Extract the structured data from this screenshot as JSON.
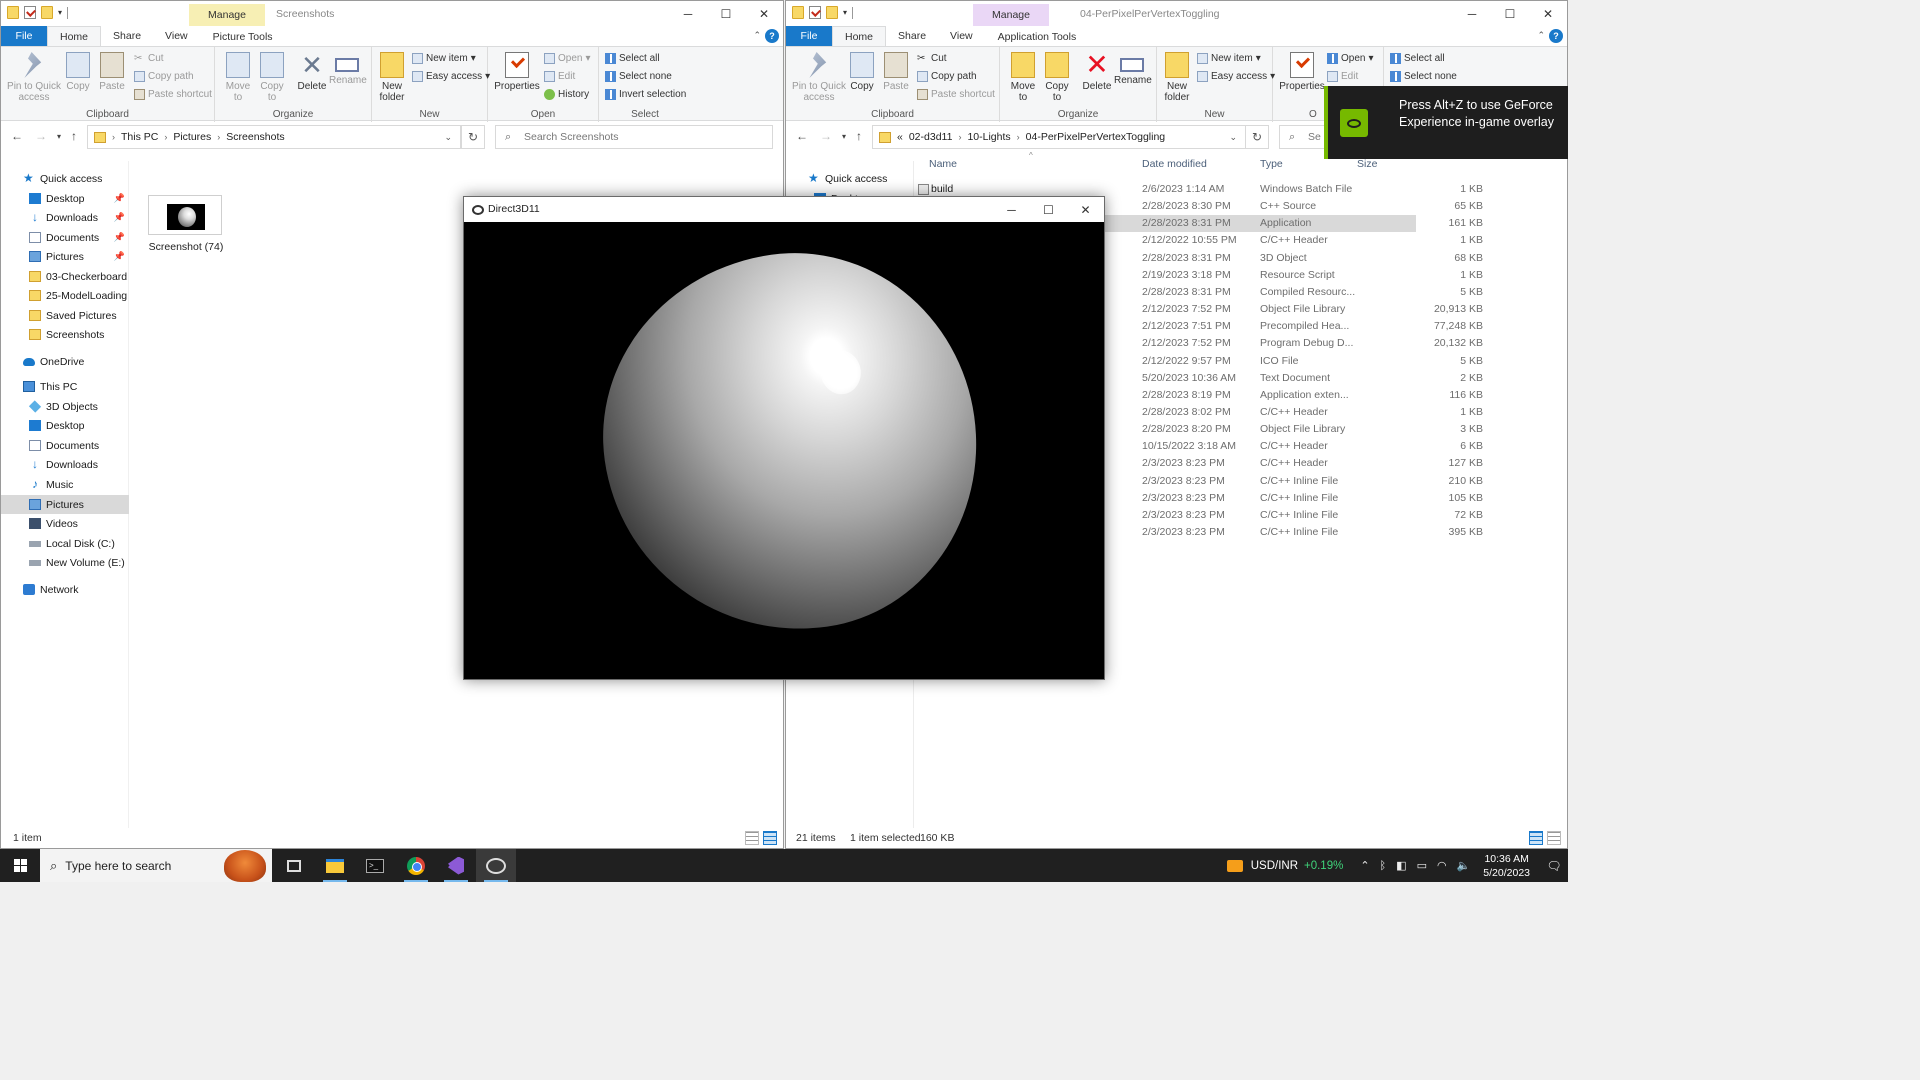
{
  "left": {
    "manage": "Manage",
    "title": "Screenshots",
    "tabs": [
      "File",
      "Home",
      "Share",
      "View",
      "Picture Tools"
    ],
    "ribbon": {
      "pin": "Pin to Quick access",
      "copy": "Copy",
      "paste": "Paste",
      "cut": "Cut",
      "copy_path": "Copy path",
      "paste_shortcut": "Paste shortcut",
      "clipboard": "Clipboard",
      "move_to": "Move to",
      "copy_to": "Copy to",
      "delete": "Delete",
      "rename": "Rename",
      "organize": "Organize",
      "new_folder": "New folder",
      "new_item": "New item",
      "easy_access": "Easy access",
      "new": "New",
      "properties": "Properties",
      "open": "Open",
      "edit": "Edit",
      "history": "History",
      "open_group": "Open",
      "select_all": "Select all",
      "select_none": "Select none",
      "invert_selection": "Invert selection",
      "select": "Select"
    },
    "path": [
      "This PC",
      "Pictures",
      "Screenshots"
    ],
    "search_placeholder": "Search Screenshots",
    "nav": {
      "quick_access": "Quick access",
      "desktop": "Desktop",
      "downloads": "Downloads",
      "documents": "Documents",
      "pictures": "Pictures",
      "checkerboard": "03-Checkerboard",
      "modelloading": "25-ModelLoading",
      "saved_pictures": "Saved Pictures",
      "screenshots": "Screenshots",
      "onedrive": "OneDrive",
      "this_pc": "This PC",
      "objects3d": "3D Objects",
      "pc_desktop": "Desktop",
      "pc_documents": "Documents",
      "pc_downloads": "Downloads",
      "music": "Music",
      "pc_pictures": "Pictures",
      "videos": "Videos",
      "local_disk": "Local Disk (C:)",
      "new_volume": "New Volume (E:)",
      "network": "Network"
    },
    "file_label": "Screenshot (74)",
    "status": "1 item"
  },
  "right": {
    "manage": "Manage",
    "title": "04-PerPixelPerVertexToggling",
    "tabs": [
      "File",
      "Home",
      "Share",
      "View",
      "Application Tools"
    ],
    "ribbon": {
      "pin": "Pin to Quick access",
      "copy": "Copy",
      "paste": "Paste",
      "cut": "Cut",
      "copy_path": "Copy path",
      "paste_shortcut": "Paste shortcut",
      "clipboard": "Clipboard",
      "move_to": "Move to",
      "copy_to": "Copy to",
      "delete": "Delete",
      "rename": "Rename",
      "organize": "Organize",
      "new_folder": "New folder",
      "new_item": "New item",
      "easy_access": "Easy access",
      "new": "New",
      "properties": "Properties",
      "open": "Open",
      "edit": "Edit",
      "open_group": "O",
      "select_all": "Select all",
      "select_none": "Select none"
    },
    "path": [
      "«",
      "02-d3d11",
      "10-Lights",
      "04-PerPixelPerVertexToggling"
    ],
    "search_placeholder": "Se",
    "nav": {
      "quick_access": "Quick access",
      "desktop": "Desktop"
    },
    "columns": [
      "Name",
      "Date modified",
      "Type",
      "Size"
    ],
    "files": [
      {
        "name": "build",
        "date": "2/6/2023 1:14 AM",
        "type": "Windows Batch File",
        "size": "1 KB"
      },
      {
        "name": "",
        "date": "2/28/2023 8:30 PM",
        "type": "C++ Source",
        "size": "65 KB"
      },
      {
        "name": "",
        "date": "2/28/2023 8:31 PM",
        "type": "Application",
        "size": "161 KB"
      },
      {
        "name": "",
        "date": "2/12/2022 10:55 PM",
        "type": "C/C++ Header",
        "size": "1 KB"
      },
      {
        "name": "",
        "date": "2/28/2023 8:31 PM",
        "type": "3D Object",
        "size": "68 KB"
      },
      {
        "name": "",
        "date": "2/19/2023 3:18 PM",
        "type": "Resource Script",
        "size": "1 KB"
      },
      {
        "name": "",
        "date": "2/28/2023 8:31 PM",
        "type": "Compiled Resourc...",
        "size": "5 KB"
      },
      {
        "name": "",
        "date": "2/12/2023 7:52 PM",
        "type": "Object File Library",
        "size": "20,913 KB"
      },
      {
        "name": "",
        "date": "2/12/2023 7:51 PM",
        "type": "Precompiled Hea...",
        "size": "77,248 KB"
      },
      {
        "name": "",
        "date": "2/12/2023 7:52 PM",
        "type": "Program Debug D...",
        "size": "20,132 KB"
      },
      {
        "name": "",
        "date": "2/12/2022 9:57 PM",
        "type": "ICO File",
        "size": "5 KB"
      },
      {
        "name": "",
        "date": "5/20/2023 10:36 AM",
        "type": "Text Document",
        "size": "2 KB"
      },
      {
        "name": "",
        "date": "2/28/2023 8:19 PM",
        "type": "Application exten...",
        "size": "116 KB"
      },
      {
        "name": "",
        "date": "2/28/2023 8:02 PM",
        "type": "C/C++ Header",
        "size": "1 KB"
      },
      {
        "name": "",
        "date": "2/28/2023 8:20 PM",
        "type": "Object File Library",
        "size": "3 KB"
      },
      {
        "name": "",
        "date": "10/15/2022 3:18 AM",
        "type": "C/C++ Header",
        "size": "6 KB"
      },
      {
        "name": "",
        "date": "2/3/2023 8:23 PM",
        "type": "C/C++ Header",
        "size": "127 KB"
      },
      {
        "name": "",
        "date": "2/3/2023 8:23 PM",
        "type": "C/C++ Inline File",
        "size": "210 KB"
      },
      {
        "name": "",
        "date": "2/3/2023 8:23 PM",
        "type": "C/C++ Inline File",
        "size": "105 KB"
      },
      {
        "name": "",
        "date": "2/3/2023 8:23 PM",
        "type": "C/C++ Inline File",
        "size": "72 KB"
      },
      {
        "name": "",
        "date": "2/3/2023 8:23 PM",
        "type": "C/C++ Inline File",
        "size": "395 KB"
      }
    ],
    "status_items": "21 items",
    "status_selected": "1 item selected",
    "status_size": "160 KB"
  },
  "overlay": {
    "text": "Press Alt+Z to use GeForce Experience in-game overlay"
  },
  "d3d": {
    "title": "Direct3D11"
  },
  "taskbar": {
    "search": "Type here to search",
    "pair": "USD/INR",
    "change": "+0.19%",
    "time": "10:36 AM",
    "date": "5/20/2023"
  }
}
